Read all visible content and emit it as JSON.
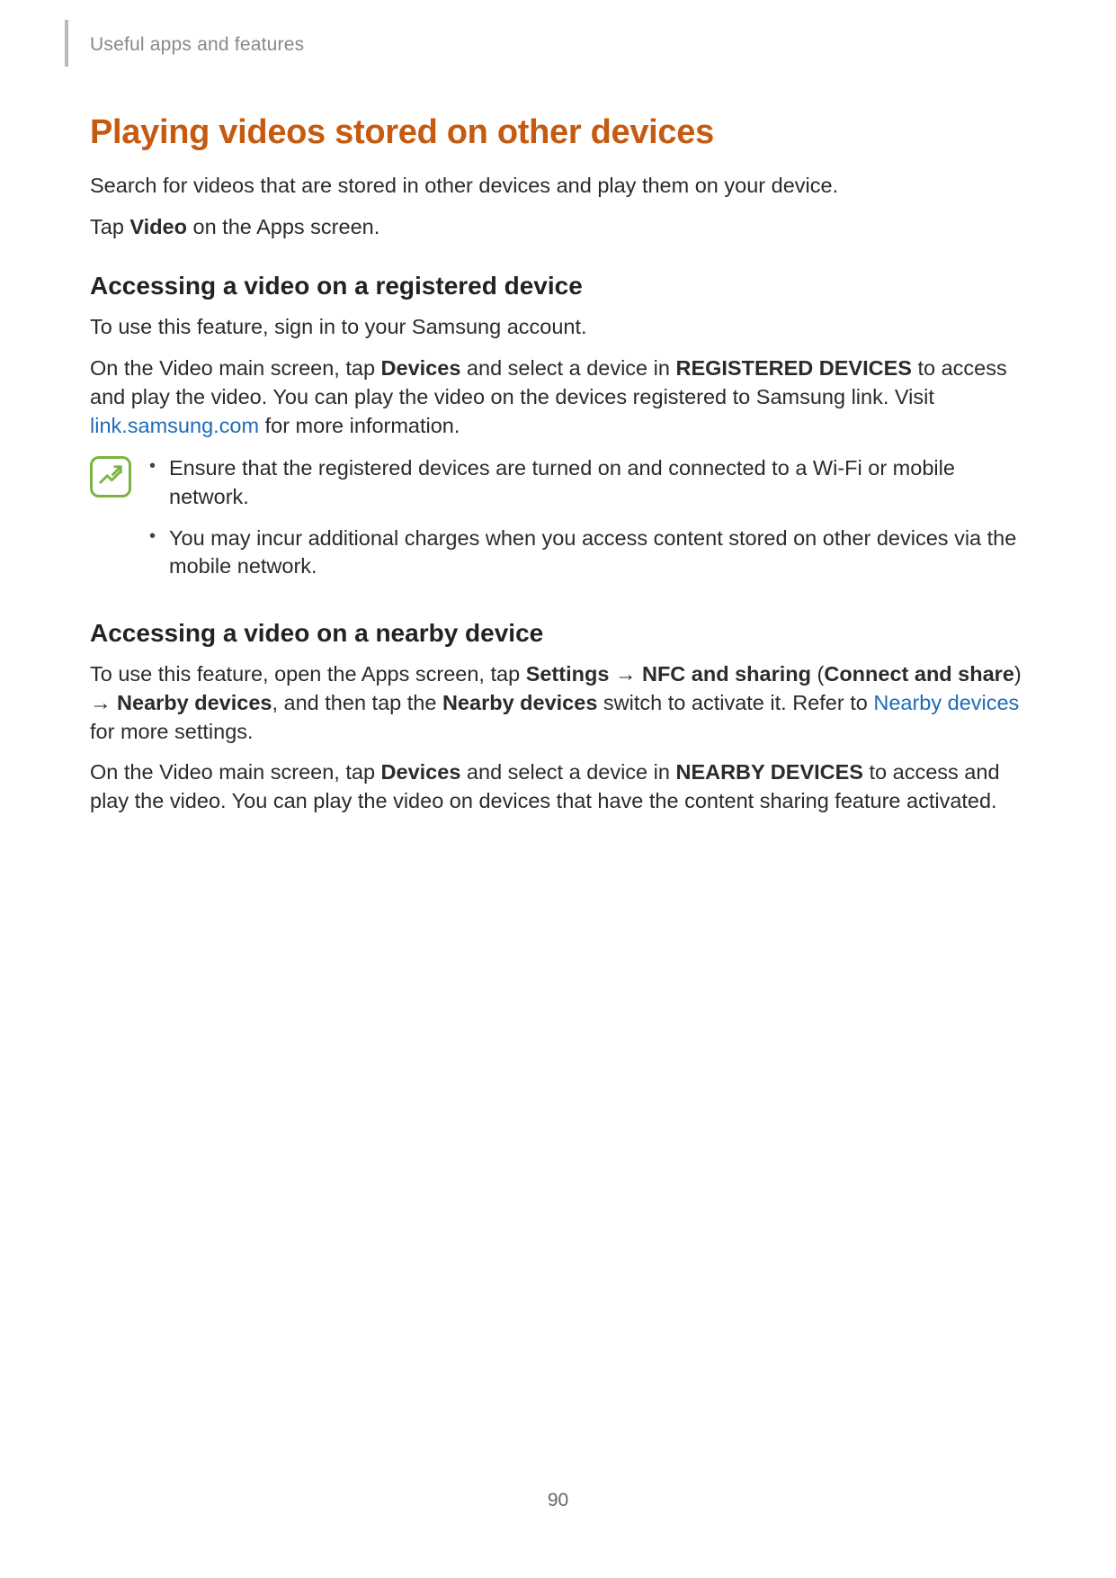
{
  "header": {
    "breadcrumb": "Useful apps and features"
  },
  "title": "Playing videos stored on other devices",
  "intro1": "Search for videos that are stored in other devices and play them on your device.",
  "intro2_pre": "Tap ",
  "intro2_bold": "Video",
  "intro2_post": " on the Apps screen.",
  "section1": {
    "heading": "Accessing a video on a registered device",
    "p1": "To use this feature, sign in to your Samsung account.",
    "p2_pre": "On the Video main screen, tap ",
    "p2_b1": "Devices",
    "p2_mid1": " and select a device in ",
    "p2_b2": "REGISTERED DEVICES",
    "p2_mid2": " to access and play the video. You can play the video on the devices registered to Samsung link. Visit ",
    "p2_link": "link.samsung.com",
    "p2_post": " for more information.",
    "note1": "Ensure that the registered devices are turned on and connected to a Wi-Fi or mobile network.",
    "note2": "You may incur additional charges when you access content stored on other devices via the mobile network."
  },
  "section2": {
    "heading": "Accessing a video on a nearby device",
    "p1_pre": "To use this feature, open the Apps screen, tap ",
    "p1_b1": "Settings",
    "p1_arr1": " → ",
    "p1_b2": "NFC and sharing",
    "p1_paren1": " (",
    "p1_b3": "Connect and share",
    "p1_paren2": ") ",
    "p1_arr2": "→ ",
    "p1_b4": "Nearby devices",
    "p1_mid": ", and then tap the ",
    "p1_b5": "Nearby devices",
    "p1_mid2": " switch to activate it. Refer to ",
    "p1_link": "Nearby devices",
    "p1_post": " for more settings.",
    "p2_pre": "On the Video main screen, tap ",
    "p2_b1": "Devices",
    "p2_mid": " and select a device in ",
    "p2_b2": "NEARBY DEVICES",
    "p2_post": " to access and play the video. You can play the video on devices that have the content sharing feature activated."
  },
  "pageNumber": "90"
}
